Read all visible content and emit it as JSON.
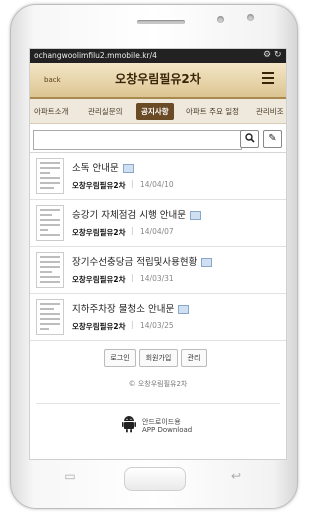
{
  "browser": {
    "url": "ochangwoolimfilu2.mmobile.kr/4",
    "gear_icon": "⚙",
    "reload_icon": "↻"
  },
  "header": {
    "back_label": "back",
    "title": "오창우림필유2차",
    "menu_icon": "hamburger-icon"
  },
  "tabs": [
    {
      "label": "아파트소개"
    },
    {
      "label": "관리실문의"
    },
    {
      "label": "공지사항",
      "active": true
    },
    {
      "label": "아파트 주요 일정"
    },
    {
      "label": "관리비조"
    }
  ],
  "toolbar": {
    "search_placeholder": "",
    "search_icon": "🔍",
    "write_icon": "✎"
  },
  "posts": [
    {
      "title": "소독 안내문",
      "author": "오창우림필유2차",
      "date": "14/04/10"
    },
    {
      "title": "승강기 자체점검 시행 안내문",
      "author": "오창우림필유2차",
      "date": "14/04/07"
    },
    {
      "title": "장기수선충당금 적립및사용현황",
      "author": "오창우림필유2차",
      "date": "14/03/31"
    },
    {
      "title": "지하주차장 물청소 안내문",
      "author": "오창우림필유2차",
      "date": "14/03/25"
    }
  ],
  "footer": {
    "buttons": [
      "로그인",
      "회원가입",
      "관리"
    ],
    "copyright": "© 오창우림필유2차",
    "app_line1": "안드로이드용",
    "app_line2": "APP Download"
  },
  "device": {
    "menu_key": "▭",
    "back_key": "↩"
  },
  "colors": {
    "header_gradient_top": "#f3e7c6",
    "header_gradient_bottom": "#dcc492",
    "active_tab": "#6b4a26",
    "url_bar": "#222222"
  }
}
